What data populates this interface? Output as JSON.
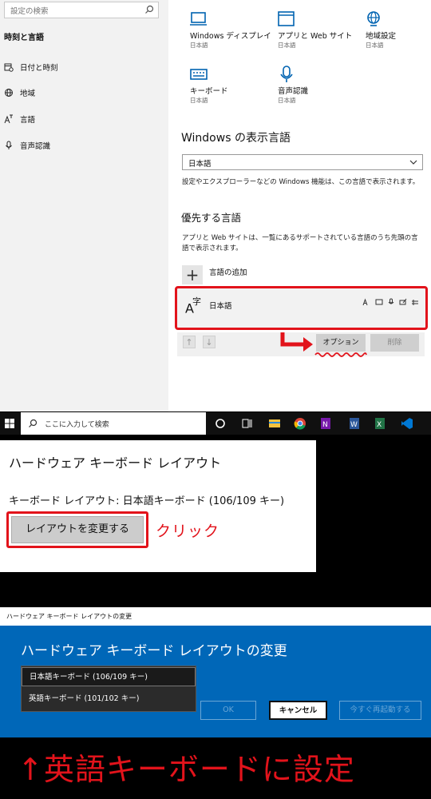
{
  "settings": {
    "search_placeholder": "設定の検索",
    "sidebar_heading": "時刻と言語",
    "nav": [
      {
        "label": "日付と時刻",
        "icon": "calendar-clock-icon"
      },
      {
        "label": "地域",
        "icon": "globe-icon"
      },
      {
        "label": "言語",
        "icon": "language-icon"
      },
      {
        "label": "音声認識",
        "icon": "microphone-icon"
      }
    ],
    "tiles": [
      {
        "title": "Windows ディスプレイ",
        "sub": "日本語",
        "icon": "monitor-icon"
      },
      {
        "title": "アプリと Web サイト",
        "sub": "日本語",
        "icon": "app-window-icon"
      },
      {
        "title": "地域設定",
        "sub": "日本語",
        "icon": "region-globe-icon"
      },
      {
        "title": "キーボード",
        "sub": "日本語",
        "icon": "keyboard-icon"
      },
      {
        "title": "音声認識",
        "sub": "日本語",
        "icon": "microphone-icon"
      }
    ],
    "display_lang_title": "Windows の表示言語",
    "display_lang_value": "日本語",
    "display_lang_desc": "設定やエクスプローラーなどの Windows 機能は、この言語で表示されます。",
    "preferred_title": "優先する言語",
    "preferred_desc": "アプリと Web サイトは、一覧にあるサポートされている言語のうち先頭の言語で表示されます。",
    "add_lang_label": "言語の追加",
    "lang_glyph_main": "A",
    "lang_glyph_sup": "字",
    "lang_name": "日本語",
    "options_label": "オプション",
    "remove_label": "削除",
    "arrow_up": "↑",
    "arrow_down": "↓"
  },
  "taskbar": {
    "search_placeholder": "ここに入力して検索"
  },
  "keyboard_panel": {
    "title": "ハードウェア キーボード レイアウト",
    "layout_line": "キーボード レイアウト: 日本語キーボード (106/109 キー)",
    "change_button": "レイアウトを変更する",
    "click_note": "クリック"
  },
  "dialog": {
    "window_title": "ハードウェア キーボード レイアウトの変更",
    "heading": "ハードウェア キーボード レイアウトの変更",
    "options": [
      "日本語キーボード (106/109 キー)",
      "英語キーボード (101/102 キー)"
    ],
    "selected_index": 0,
    "ok_label": "OK",
    "cancel_label": "キャンセル",
    "restart_label": "今すぐ再起動する"
  },
  "caption": "↑英語キーボードに設定",
  "colors": {
    "highlight_red": "#e2131b",
    "accent_blue": "#0067b8",
    "icon_blue": "#0063b1"
  }
}
